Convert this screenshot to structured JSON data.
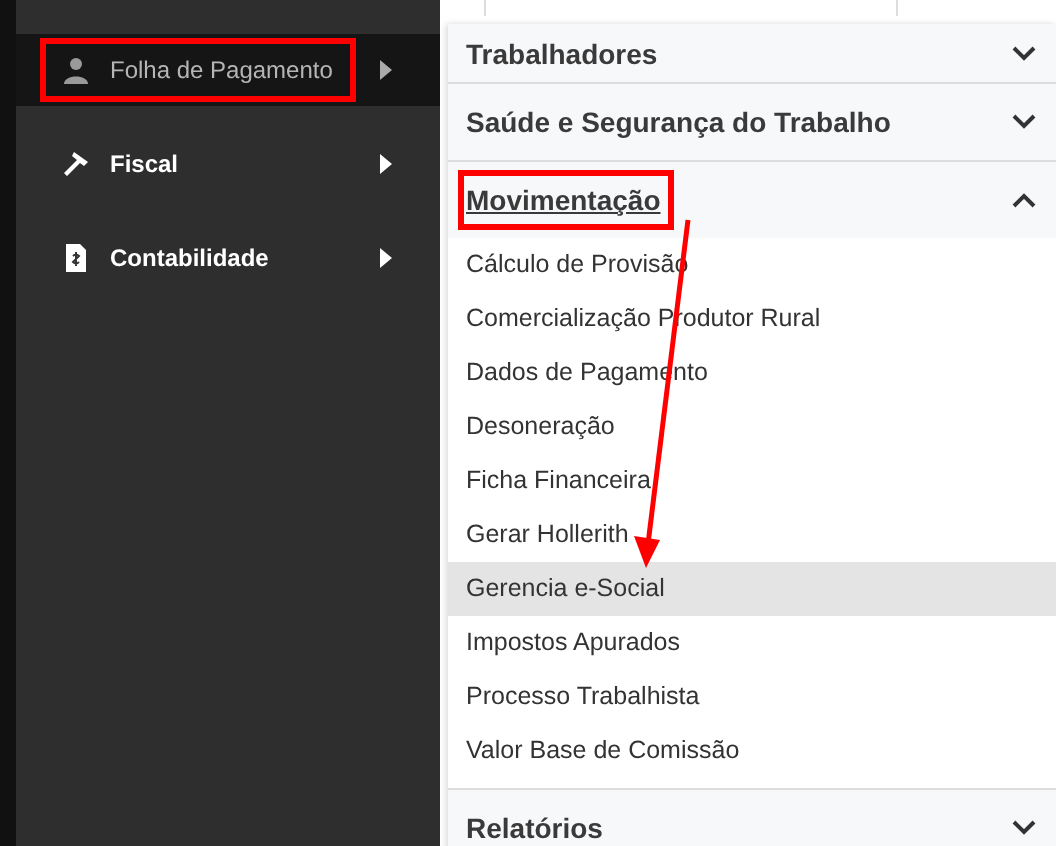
{
  "sidebar": {
    "items": [
      {
        "label": "Folha de Pagamento",
        "selected": true,
        "highlighted": true
      },
      {
        "label": "Fiscal",
        "selected": false,
        "highlighted": false
      },
      {
        "label": "Contabilidade",
        "selected": false,
        "highlighted": false
      }
    ]
  },
  "menu": {
    "sections": [
      {
        "title": "Trabalhadores",
        "expanded": false,
        "highlighted": false
      },
      {
        "title": "Saúde e Segurança do Trabalho",
        "expanded": false,
        "highlighted": false
      },
      {
        "title": "Movimentação",
        "expanded": true,
        "highlighted": true,
        "items": [
          {
            "label": "Cálculo de Provisão",
            "selected": false
          },
          {
            "label": "Comercialização Produtor Rural",
            "selected": false
          },
          {
            "label": "Dados de Pagamento",
            "selected": false
          },
          {
            "label": "Desoneração",
            "selected": false
          },
          {
            "label": "Ficha Financeira",
            "selected": false
          },
          {
            "label": "Gerar Hollerith",
            "selected": false
          },
          {
            "label": "Gerencia e-Social",
            "selected": true
          },
          {
            "label": "Impostos Apurados",
            "selected": false
          },
          {
            "label": "Processo Trabalhista",
            "selected": false
          },
          {
            "label": "Valor Base de Comissão",
            "selected": false
          }
        ]
      },
      {
        "title": "Relatórios",
        "expanded": false,
        "highlighted": false
      }
    ]
  }
}
